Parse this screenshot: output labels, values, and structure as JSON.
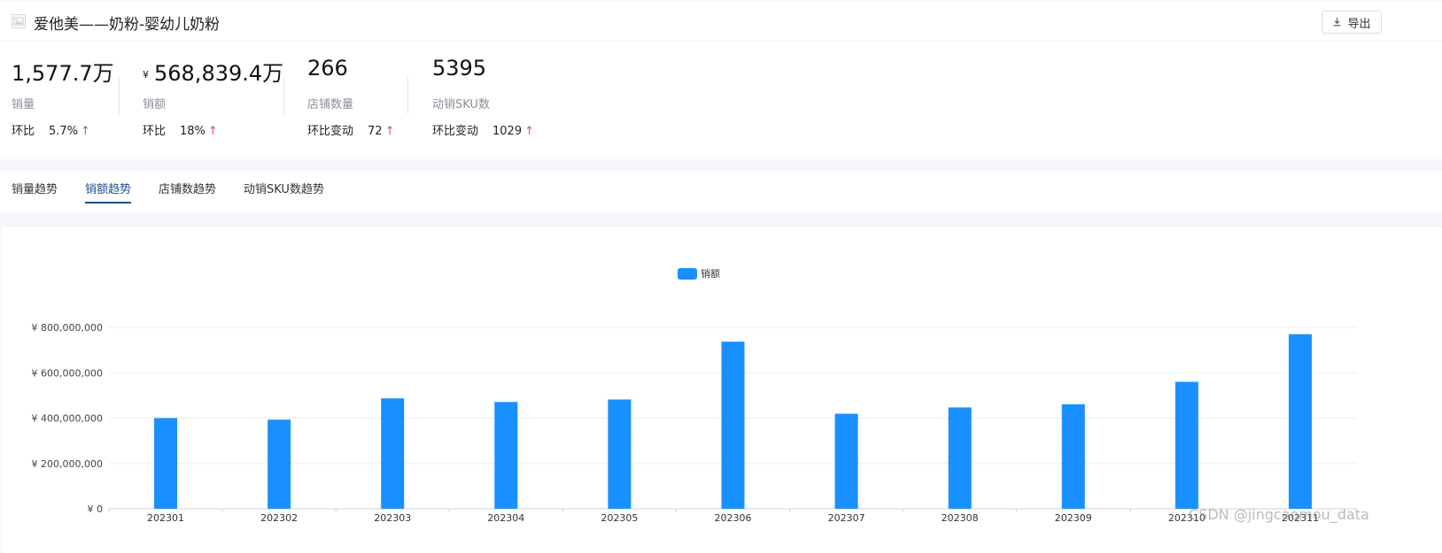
{
  "header": {
    "title": "爱他美——奶粉-婴幼儿奶粉",
    "export_label": "导出"
  },
  "stats": [
    {
      "value": "1,577.7万",
      "currency": "",
      "label": "销量",
      "change_label": "环比",
      "change_value": "5.7%",
      "direction": "up"
    },
    {
      "value": "568,839.4万",
      "currency": "¥",
      "label": "销额",
      "change_label": "环比",
      "change_value": "18%",
      "direction": "up"
    },
    {
      "value": "266",
      "currency": "",
      "label": "店铺数量",
      "change_label": "环比变动",
      "change_value": "72",
      "direction": "up"
    },
    {
      "value": "5395",
      "currency": "",
      "label": "动销SKU数",
      "change_label": "环比变动",
      "change_value": "1029",
      "direction": "up"
    }
  ],
  "tabs": [
    {
      "label": "销量趋势",
      "active": false
    },
    {
      "label": "销额趋势",
      "active": true
    },
    {
      "label": "店铺数趋势",
      "active": false
    },
    {
      "label": "动销SKU数趋势",
      "active": false
    }
  ],
  "chart_data": {
    "type": "bar",
    "title": "",
    "legend": [
      "销额"
    ],
    "legend_position": "top-center",
    "color": "#1890ff",
    "categories": [
      "202301",
      "202302",
      "202303",
      "202304",
      "202305",
      "202306",
      "202307",
      "202308",
      "202309",
      "202310",
      "202311"
    ],
    "series": [
      {
        "name": "销额",
        "values": [
          400000000,
          393000000,
          487000000,
          471000000,
          482000000,
          737000000,
          419000000,
          447000000,
          461000000,
          560000000,
          770000000
        ]
      }
    ],
    "ylim": [
      0,
      800000000
    ],
    "yticks": [
      0,
      200000000,
      400000000,
      600000000,
      800000000
    ],
    "ytick_labels": [
      "¥ 0",
      "¥ 200,000,000",
      "¥ 400,000,000",
      "¥ 600,000,000",
      "¥ 800,000,000"
    ],
    "grid": true,
    "xlabel": "",
    "ylabel": ""
  },
  "watermark": "CSDN @jingcaomou_data"
}
